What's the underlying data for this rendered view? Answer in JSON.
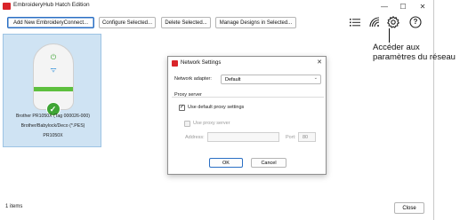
{
  "window": {
    "title": "EmbroideryHub Hatch Edition",
    "minimize_glyph": "—",
    "maximize_glyph": "☐",
    "close_glyph": "✕"
  },
  "toolbar": {
    "add_label": "Add New EmbroideryConnect...",
    "configure_label": "Configure Selected...",
    "delete_label": "Delete Selected...",
    "manage_label": "Manage Designs in Selected...",
    "icons": [
      "list-icon",
      "network-signal-icon",
      "settings-gear-icon",
      "help-icon"
    ],
    "help_glyph": "?"
  },
  "annotation": {
    "line1": "Accéder aux",
    "line2": "paramètres du réseau"
  },
  "device": {
    "line1": "Brother PR1050X (Tag 000026-000)",
    "line2": "Brother/Babylock/Deco (*.PES)",
    "line3": "PR1050X",
    "power_glyph": "⏻",
    "wifi_glyph": "ᯤ",
    "check_glyph": "✓",
    "accent_color": "#5dbf3e"
  },
  "status": {
    "items_text": "1 items"
  },
  "footer": {
    "close_label": "Close"
  },
  "dialog": {
    "title": "Network Settings",
    "close_glyph": "✕",
    "adapter_label": "Network adapter:",
    "adapter_value": "Default",
    "proxy_section_label": "Proxy server",
    "use_default_label": "Use default proxy settings",
    "use_default_checked": true,
    "use_proxy_label": "Use proxy server",
    "use_proxy_checked": false,
    "address_label": "Address:",
    "address_value": "",
    "port_label": "Port:",
    "port_value": "80",
    "ok_label": "OK",
    "cancel_label": "Cancel"
  },
  "colors": {
    "brand_red": "#d9242a",
    "selection_bg": "#cfe3f3",
    "focus_blue": "#2a6fc4"
  }
}
